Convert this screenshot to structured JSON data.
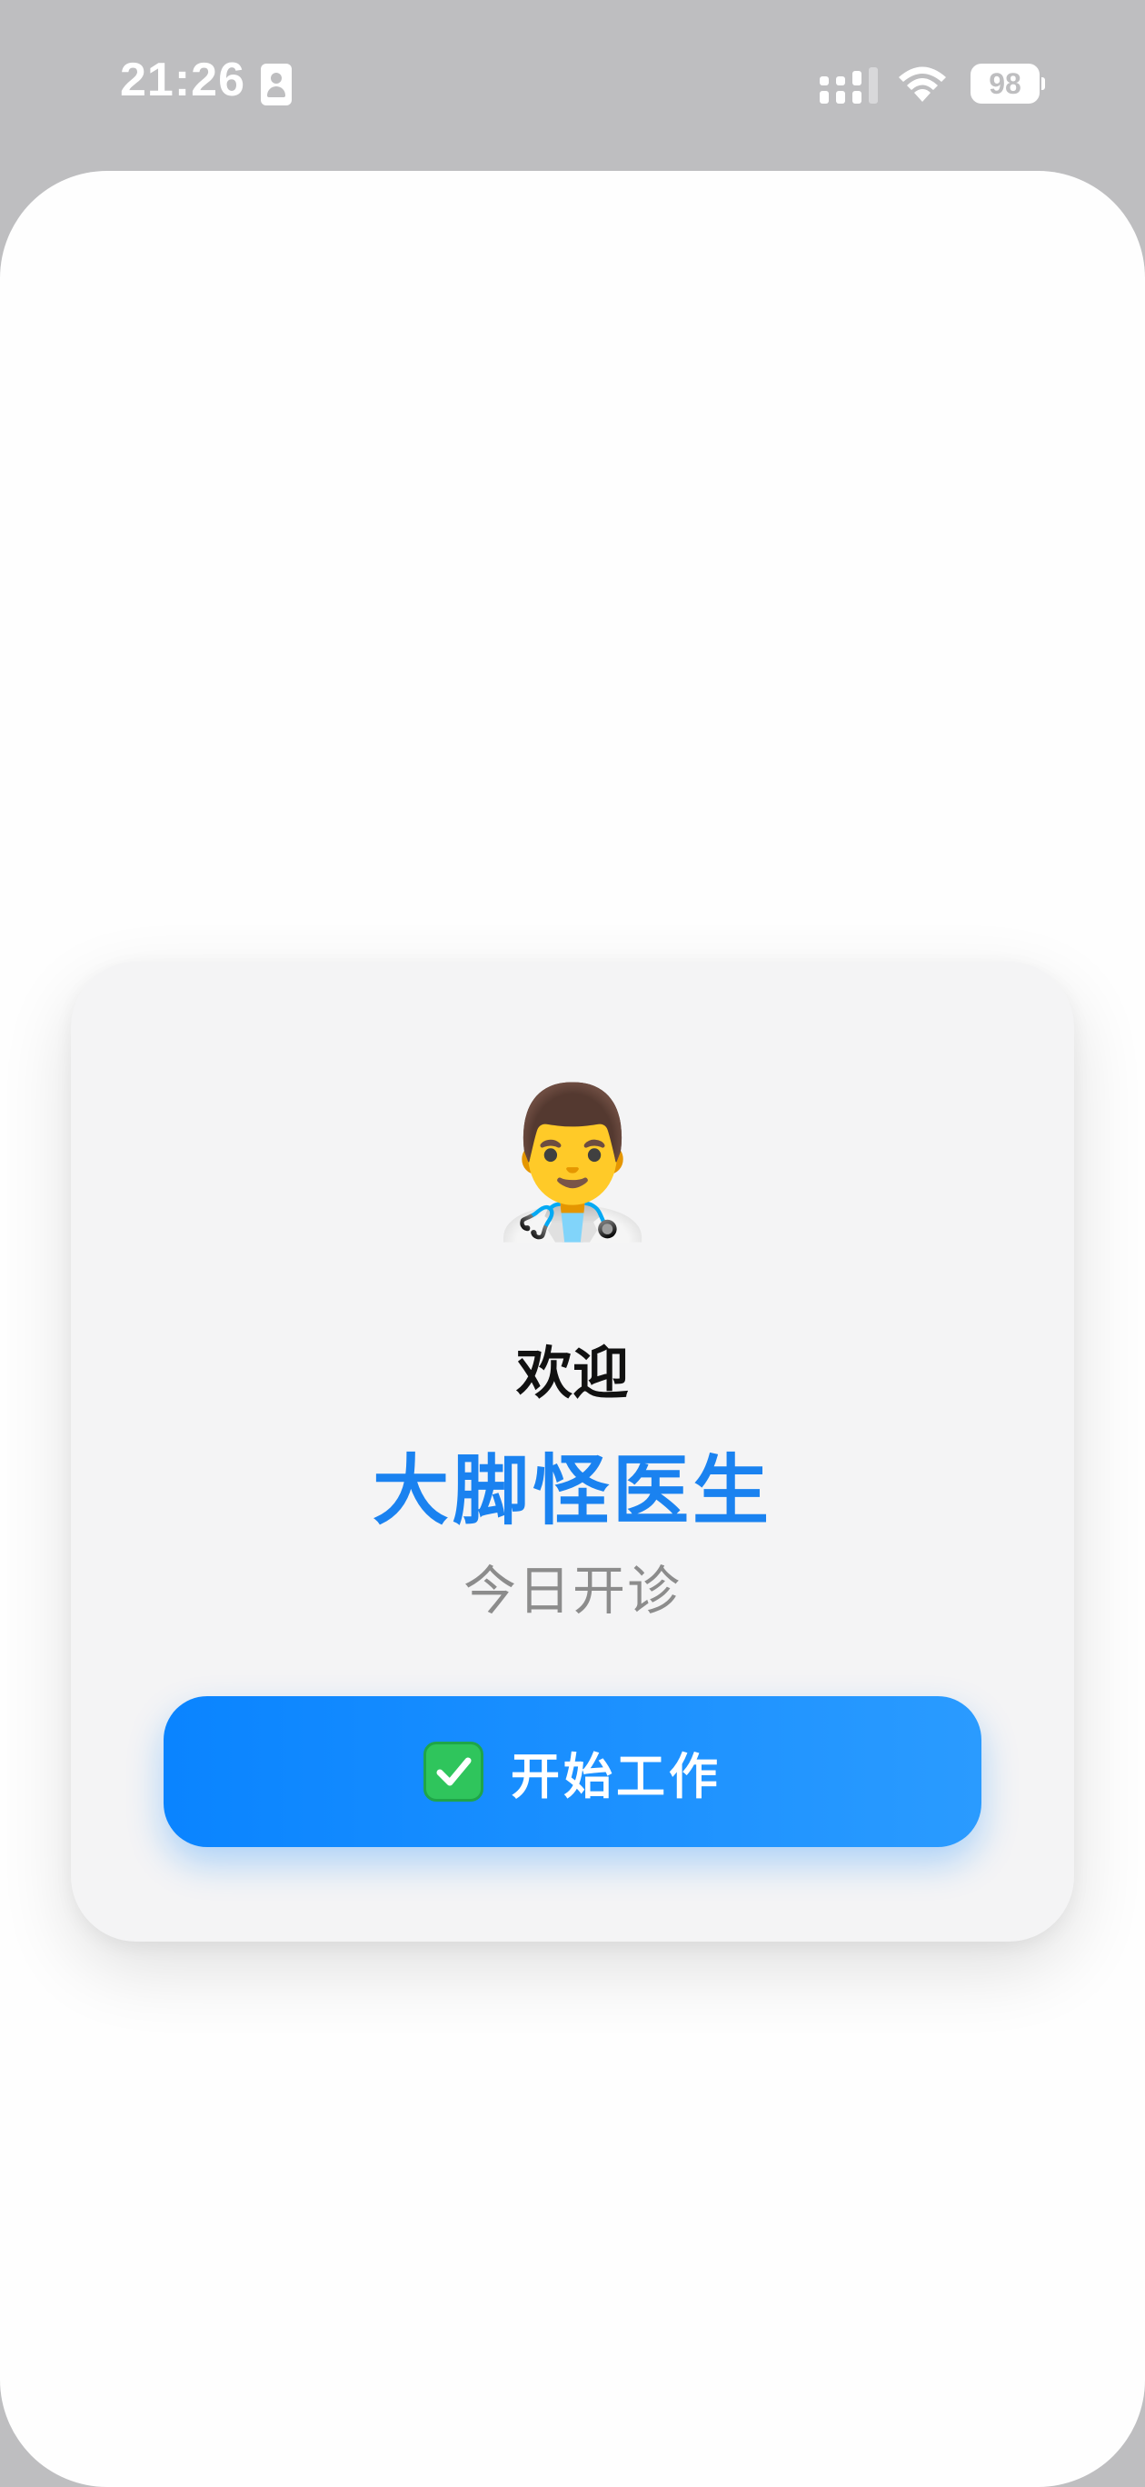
{
  "status_bar": {
    "time": "21:26",
    "battery": "98",
    "icons": [
      "id-card-icon",
      "signal-icon",
      "wifi-icon",
      "battery-icon"
    ]
  },
  "card": {
    "avatar_emoji": "👨‍⚕️",
    "welcome": "欢迎",
    "doctor_name": "大脚怪医生",
    "subtitle": "今日开诊",
    "start_button": {
      "icon": "✅",
      "label": "开始工作"
    }
  },
  "colors": {
    "accent": "#1a82f0",
    "button_start": "#0a84ff",
    "button_end": "#2a9bff",
    "card_bg": "#f4f4f5",
    "status_bar_bg": "#bebec0"
  }
}
